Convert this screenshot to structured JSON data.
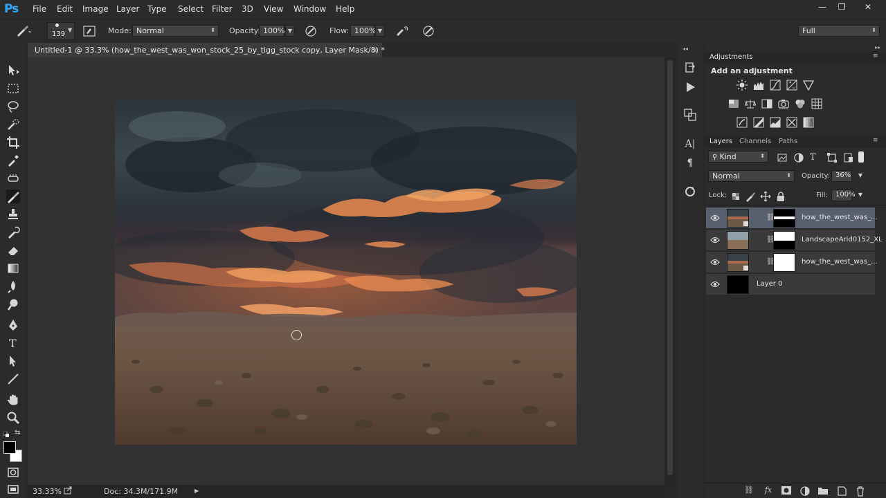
{
  "app": {
    "logo": "Ps"
  },
  "menu": [
    "File",
    "Edit",
    "Image",
    "Layer",
    "Type",
    "Select",
    "Filter",
    "3D",
    "View",
    "Window",
    "Help"
  ],
  "window_controls": {
    "minimize": "—",
    "restore": "❐",
    "close": "✕"
  },
  "options_bar": {
    "brush_size": "139",
    "mode_label": "Mode:",
    "mode_value": "Normal",
    "opacity_label": "Opacity:",
    "opacity_value": "100%",
    "flow_label": "Flow:",
    "flow_value": "100%",
    "workspace_value": "Full"
  },
  "document": {
    "tab_title": "Untitled-1 @ 33.3% (how_the_west_was_won_stock_25_by_tigg_stock copy, Layer Mask/8) *",
    "close_symbol": "×"
  },
  "status": {
    "zoom": "33.33%",
    "doc_size": "Doc: 34.3M/171.9M"
  },
  "adjustments_panel": {
    "title": "Adjustments",
    "subtitle": "Add an adjustment"
  },
  "layers_panel": {
    "tabs": [
      "Layers",
      "Channels",
      "Paths"
    ],
    "filter_kind": "Kind",
    "blend_mode": "Normal",
    "opacity_label": "Opacity:",
    "opacity_value": "36%",
    "lock_label": "Lock:",
    "fill_label": "Fill:",
    "fill_value": "100%",
    "layers": [
      {
        "name": "how_the_west_was_...",
        "selected": true,
        "mask": "band"
      },
      {
        "name": "LandscapeArid0152_XL",
        "selected": false,
        "mask": "top-white"
      },
      {
        "name": "how_the_west_was_...",
        "selected": false,
        "mask": "white"
      },
      {
        "name": "Layer 0",
        "selected": false,
        "mask": "none"
      }
    ]
  },
  "colors": {
    "accent": "#31a8ff",
    "panel_bg": "#2b2b2b",
    "workspace_bg": "#323232",
    "selected_layer": "#58606f"
  }
}
